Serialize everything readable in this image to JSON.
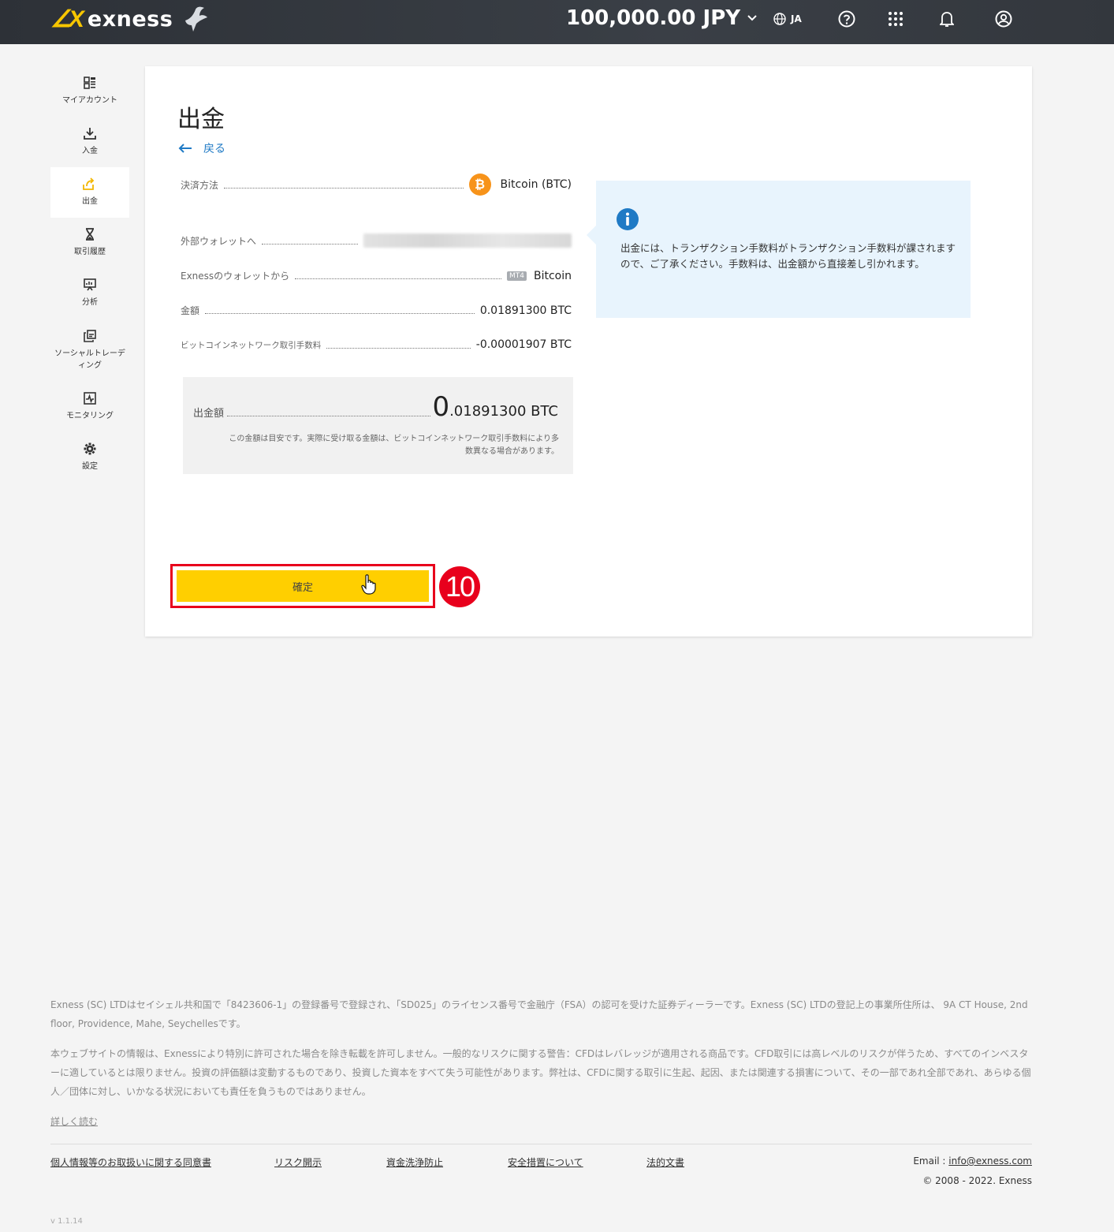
{
  "header": {
    "logo_mark": "∠X",
    "logo_text": "exness",
    "balance": "100,000.00 JPY",
    "language": "JA"
  },
  "sidebar": {
    "items": [
      {
        "label": "マイアカウント",
        "icon": "dashboard-icon"
      },
      {
        "label": "入金",
        "icon": "download-icon"
      },
      {
        "label": "出金",
        "icon": "withdraw-icon",
        "active": true
      },
      {
        "label": "取引履歴",
        "icon": "hourglass-icon"
      },
      {
        "label": "分析",
        "icon": "analytics-icon"
      },
      {
        "label": "ソーシャルトレーディング",
        "icon": "copy-icon"
      },
      {
        "label": "モニタリング",
        "icon": "monitoring-icon"
      },
      {
        "label": "設定",
        "icon": "gear-icon"
      }
    ]
  },
  "main": {
    "title": "出金",
    "back": "戻る",
    "rows": {
      "method_label": "決済方法",
      "method_value": "Bitcoin (BTC)",
      "wallet_to_label": "外部ウォレットへ",
      "wallet_from_label": "Exnessのウォレットから",
      "wallet_from_badge": "MT4",
      "wallet_from_value": "Bitcoin",
      "amount_label": "金額",
      "amount_value": "0.01891300 BTC",
      "fee_label": "ビットコインネットワーク取引手数料",
      "fee_value": "-0.00001907 BTC"
    },
    "summary": {
      "label": "出金額",
      "value_big": "0",
      "value_rest": ".01891300 BTC",
      "note": "この金額は目安です。実際に受け取る金額は、ビットコインネットワーク取引手数料により多数異なる場合があります。"
    },
    "info": {
      "text": "出金には、トランザクション手数料がトランザクション手数料が課されますので、ご了承ください。手数料は、出金額から直接差し引かれます。"
    },
    "confirm_label": "確定",
    "step_number": "10"
  },
  "footer": {
    "legal_1": "Exness (SC) LTDはセイシェル共和国で「8423606-1」の登録番号で登録され、「SD025」のライセンス番号で金融庁（FSA）の認可を受けた証券ディーラーです。Exness (SC) LTDの登記上の事業所住所は、 9A CT House, 2nd floor, Providence, Mahe, Seychellesです。",
    "legal_2": "本ウェブサイトの情報は、Exnessにより特別に許可された場合を除き転載を許可しません。一般的なリスクに関する警告：CFDはレバレッジが適用される商品です。CFD取引には高レベルのリスクが伴うため、すべてのインベスターに適しているとは限りません。投資の評価額は変動するものであり、投資した資本をすべて失う可能性があります。弊社は、CFDに関する取引に生起、起因、または関連する損害について、その一部であれ全部であれ、あらゆる個人／団体に対し、いかなる状況においても責任を負うものではありません。",
    "read_more": "詳しく読む",
    "links": [
      "個人情報等のお取扱いに関する同意書",
      "リスク開示",
      "資金洗浄防止",
      "安全措置について",
      "法的文書"
    ],
    "email_label": "Email : ",
    "email": "info@exness.com",
    "copyright": "© 2008 - 2022. Exness",
    "version": "v 1.1.14"
  }
}
